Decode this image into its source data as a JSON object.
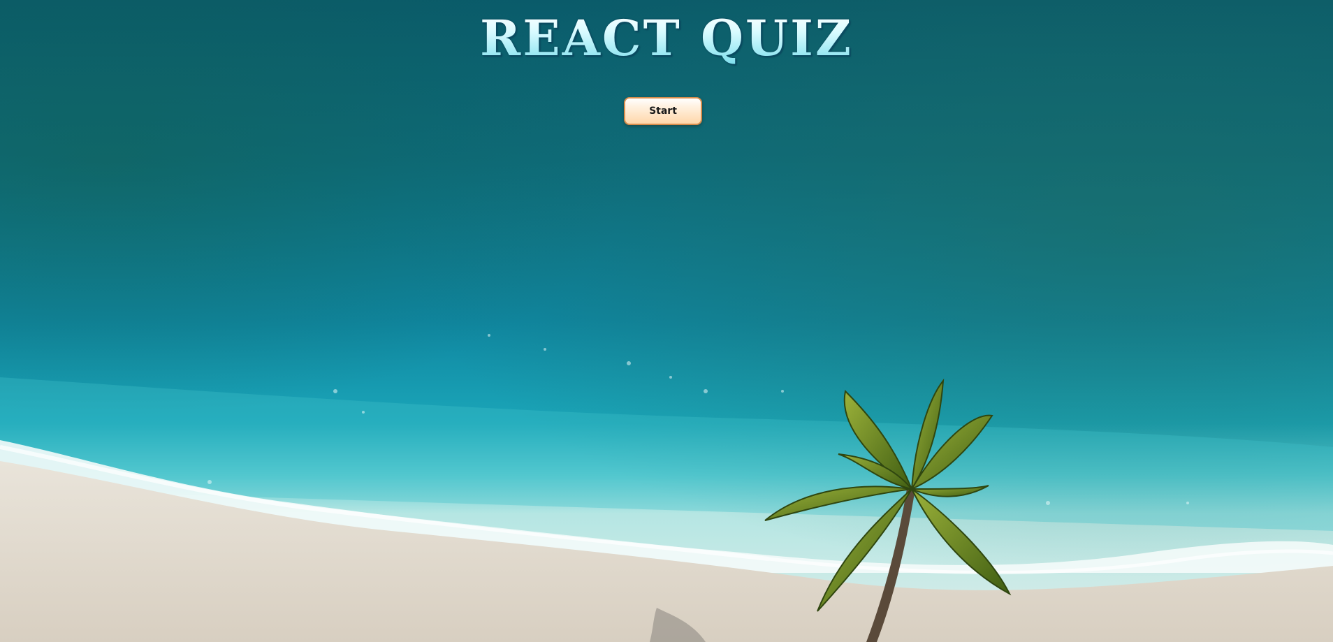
{
  "quiz": {
    "title": "React Quiz",
    "start_label": "Start"
  },
  "colors": {
    "title": "#c9f6fb",
    "title_outline": "#0a4b61",
    "button_fill": "#ffd7aa",
    "button_border": "#d88d4c",
    "button_text": "#1b1b1b",
    "deep_ocean": "#0b5e70",
    "shallow_water": "#2fb7c4",
    "surf": "#e8f6f5",
    "sand": "#e3dccf",
    "palm_leaf": "#5b7a1e"
  },
  "background": {
    "description_icons": [
      "ocean-water",
      "wave-foam",
      "sand-beach",
      "palm-tree"
    ]
  }
}
